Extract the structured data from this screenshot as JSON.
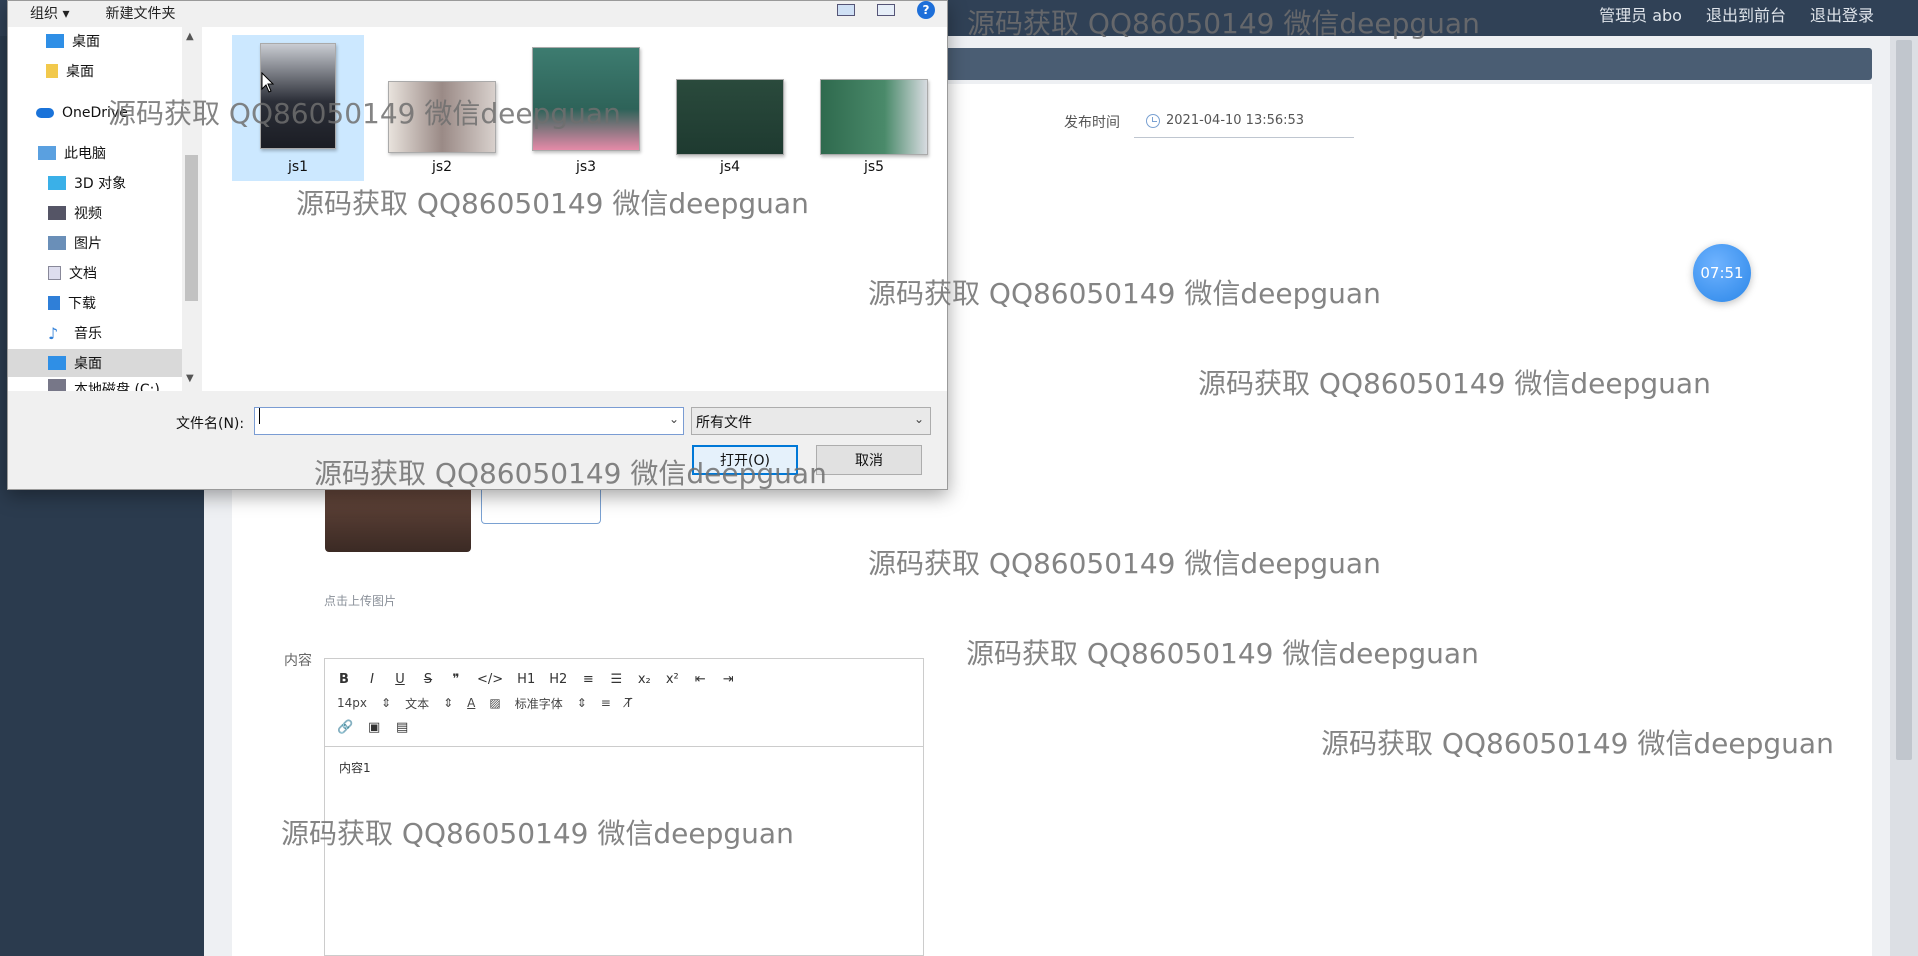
{
  "app": {
    "topbar_links": [
      "管理员 abo",
      "退出到前台",
      "退出登录"
    ],
    "publish_time_label": "发布时间",
    "publish_time_value": "2021-04-10 13:56:53",
    "timer": "07:51",
    "upload_hint": "点击上传图片",
    "content_label": "内容",
    "editor": {
      "row1": [
        "B",
        "I",
        "U",
        "S",
        "❞",
        "</>",
        "H1",
        "H2",
        "≡",
        "☰",
        "x₂",
        "x²",
        "⇤",
        "⇥"
      ],
      "font_size": "14px",
      "text_type": "文本",
      "font_family": "标准字体",
      "body": "内容1"
    }
  },
  "dialog": {
    "cmd_organize": "组织 ▾",
    "cmd_new_folder": "新建文件夹",
    "nav": [
      {
        "label": "桌面",
        "icon": "desktop-icon"
      },
      {
        "label": "桌面",
        "icon": "folder-icon"
      },
      {
        "label": "OneDrive",
        "icon": "cloud-icon"
      },
      {
        "label": "此电脑",
        "icon": "computer-icon"
      },
      {
        "label": "3D 对象",
        "icon": "cube-icon"
      },
      {
        "label": "视频",
        "icon": "video-icon"
      },
      {
        "label": "图片",
        "icon": "picture-icon"
      },
      {
        "label": "文档",
        "icon": "document-icon"
      },
      {
        "label": "下载",
        "icon": "download-icon"
      },
      {
        "label": "音乐",
        "icon": "music-icon"
      },
      {
        "label": "桌面",
        "icon": "desktop-icon"
      },
      {
        "label": "本地磁盘 (C:)",
        "icon": "drive-icon"
      }
    ],
    "files": [
      "js1",
      "js2",
      "js3",
      "js4",
      "js5"
    ],
    "filename_label": "文件名(N):",
    "filename_value": "",
    "filter_value": "所有文件",
    "open_label": "打开(O)",
    "cancel_label": "取消"
  },
  "watermark": "源码获取 QQ86050149 微信deepguan"
}
